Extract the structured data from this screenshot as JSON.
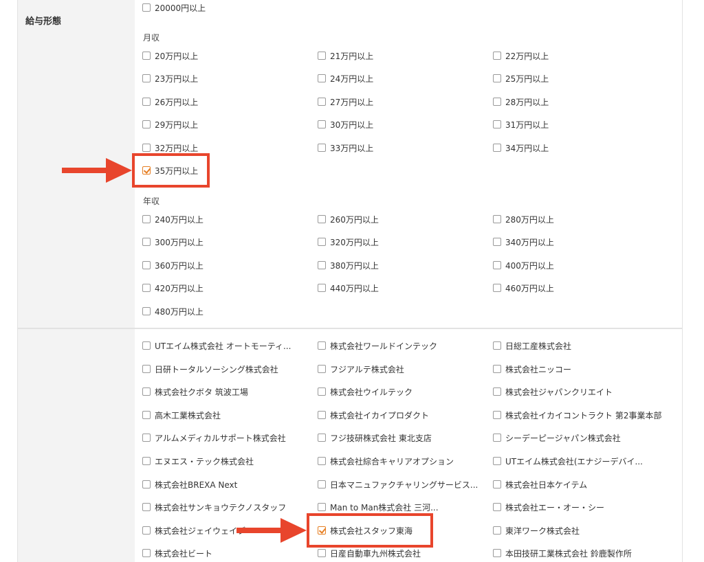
{
  "section_label": "給与形態",
  "monthly_heading": "月収",
  "annual_heading": "年収",
  "top_option": {
    "label": "20000円以上",
    "checked": false
  },
  "monthly": [
    {
      "label": "20万円以上",
      "checked": false
    },
    {
      "label": "21万円以上",
      "checked": false
    },
    {
      "label": "22万円以上",
      "checked": false
    },
    {
      "label": "23万円以上",
      "checked": false
    },
    {
      "label": "24万円以上",
      "checked": false
    },
    {
      "label": "25万円以上",
      "checked": false
    },
    {
      "label": "26万円以上",
      "checked": false
    },
    {
      "label": "27万円以上",
      "checked": false
    },
    {
      "label": "28万円以上",
      "checked": false
    },
    {
      "label": "29万円以上",
      "checked": false
    },
    {
      "label": "30万円以上",
      "checked": false
    },
    {
      "label": "31万円以上",
      "checked": false
    },
    {
      "label": "32万円以上",
      "checked": false
    },
    {
      "label": "33万円以上",
      "checked": false
    },
    {
      "label": "34万円以上",
      "checked": false
    },
    {
      "label": "35万円以上",
      "checked": true
    }
  ],
  "annual": [
    {
      "label": "240万円以上",
      "checked": false
    },
    {
      "label": "260万円以上",
      "checked": false
    },
    {
      "label": "280万円以上",
      "checked": false
    },
    {
      "label": "300万円以上",
      "checked": false
    },
    {
      "label": "320万円以上",
      "checked": false
    },
    {
      "label": "340万円以上",
      "checked": false
    },
    {
      "label": "360万円以上",
      "checked": false
    },
    {
      "label": "380万円以上",
      "checked": false
    },
    {
      "label": "400万円以上",
      "checked": false
    },
    {
      "label": "420万円以上",
      "checked": false
    },
    {
      "label": "440万円以上",
      "checked": false
    },
    {
      "label": "460万円以上",
      "checked": false
    },
    {
      "label": "480万円以上",
      "checked": false
    }
  ],
  "companies": [
    {
      "label": "UTエイム株式会社 オートモーティ...",
      "checked": false
    },
    {
      "label": "株式会社ワールドインテック",
      "checked": false
    },
    {
      "label": "日総工産株式会社",
      "checked": false
    },
    {
      "label": "日研トータルソーシング株式会社",
      "checked": false
    },
    {
      "label": "フジアルテ株式会社",
      "checked": false
    },
    {
      "label": "株式会社ニッコー",
      "checked": false
    },
    {
      "label": "株式会社クボタ 筑波工場",
      "checked": false
    },
    {
      "label": "株式会社ウイルテック",
      "checked": false
    },
    {
      "label": "株式会社ジャパンクリエイト",
      "checked": false
    },
    {
      "label": "高木工業株式会社",
      "checked": false
    },
    {
      "label": "株式会社イカイプロダクト",
      "checked": false
    },
    {
      "label": "株式会社イカイコントラクト 第2事業本部",
      "checked": false
    },
    {
      "label": "アルムメディカルサポート株式会社",
      "checked": false
    },
    {
      "label": "フジ技研株式会社 東北支店",
      "checked": false
    },
    {
      "label": "シーデーピージャパン株式会社",
      "checked": false
    },
    {
      "label": "エヌエス・テック株式会社",
      "checked": false
    },
    {
      "label": "株式会社綜合キャリアオプション",
      "checked": false
    },
    {
      "label": "UTエイム株式会社(エナジーデバイ...",
      "checked": false
    },
    {
      "label": "株式会社BREXA Next",
      "checked": false
    },
    {
      "label": "日本マニュファクチャリングサービス...",
      "checked": false
    },
    {
      "label": "株式会社日本ケイテム",
      "checked": false
    },
    {
      "label": "株式会社サンキョウテクノスタッフ",
      "checked": false
    },
    {
      "label": "Man to Man株式会社 三河...",
      "checked": false
    },
    {
      "label": "株式会社エー・オー・シー",
      "checked": false
    },
    {
      "label": "株式会社ジェイウェイブ",
      "checked": false
    },
    {
      "label": "株式会社スタッフ東海",
      "checked": true
    },
    {
      "label": "東洋ワーク株式会社",
      "checked": false
    },
    {
      "label": "株式会社ビート",
      "checked": false
    },
    {
      "label": "日産自動車九州株式会社",
      "checked": false
    },
    {
      "label": "本田技研工業株式会社 鈴鹿製作所",
      "checked": false
    }
  ],
  "colors": {
    "highlight": "#e8452c",
    "check": "#e67e22",
    "label_bg": "#f3f3f3"
  }
}
